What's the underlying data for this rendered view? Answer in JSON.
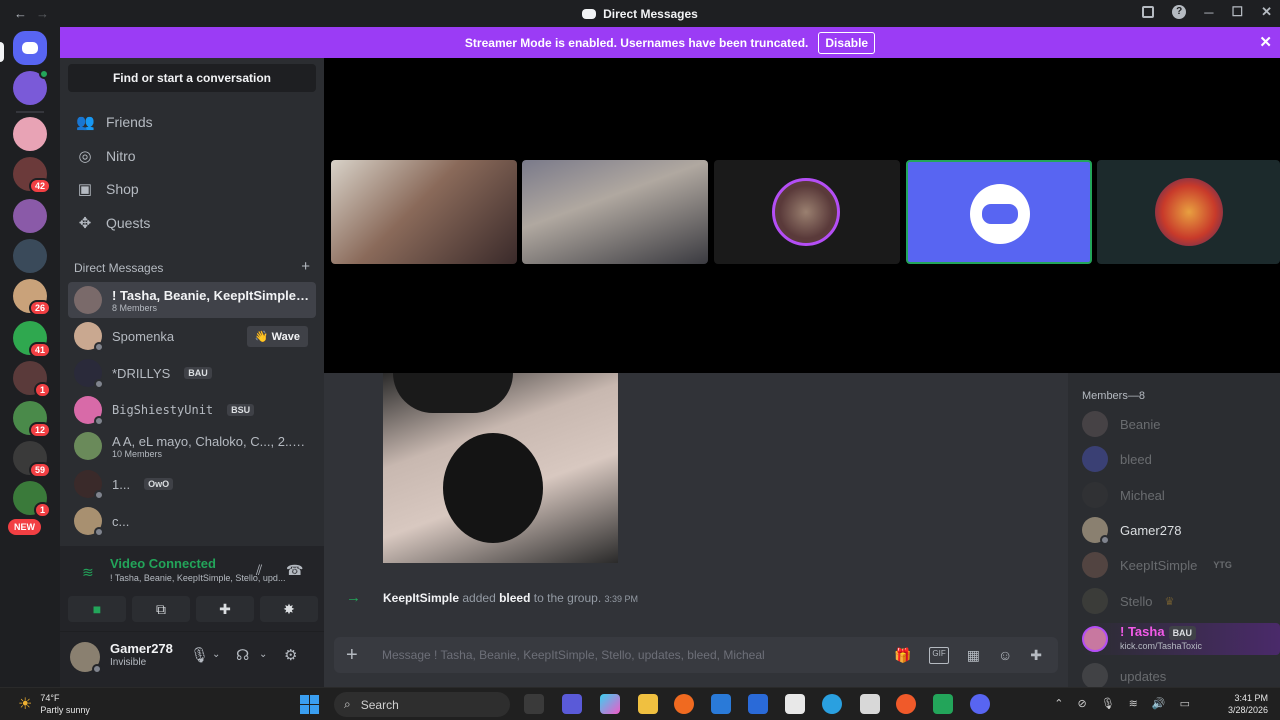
{
  "window": {
    "title": "Direct Messages",
    "back_icon": "arrow-left-icon",
    "forward_icon": "arrow-right-icon"
  },
  "banner": {
    "text": "Streamer Mode is enabled. Usernames have been truncated.",
    "button": "Disable",
    "color": "#9b3cf5"
  },
  "rail": {
    "badges": [
      "42",
      "26",
      "41",
      "1",
      "12",
      "59",
      "1"
    ],
    "new_label": "NEW"
  },
  "sidebar": {
    "search": "Find or start a conversation",
    "nav": [
      {
        "label": "Friends",
        "icon": "friends-icon"
      },
      {
        "label": "Nitro",
        "icon": "nitro-icon"
      },
      {
        "label": "Shop",
        "icon": "shop-icon"
      },
      {
        "label": "Quests",
        "icon": "quests-icon"
      }
    ],
    "dm_header": "Direct Messages",
    "dms": [
      {
        "name": "! Tasha, Beanie, KeepItSimple, St...",
        "sub": "8 Members"
      },
      {
        "name": "Spomenka",
        "action": "Wave"
      },
      {
        "name": "*DRILLYS",
        "tag": "BAU"
      },
      {
        "name": "BigShiestyUnit",
        "tag": "BSU"
      },
      {
        "name": "A A, eL mayo, Chaloko, C..., 2..., ...",
        "sub": "10 Members"
      },
      {
        "name": "1...",
        "tag": "OwO"
      },
      {
        "name": "c..."
      }
    ]
  },
  "voice": {
    "title": "Video Connected",
    "sub": "! Tasha, Beanie, KeepItSimple, Stello, upd..."
  },
  "user": {
    "name": "Gamer278",
    "status": "Invisible"
  },
  "chat": {
    "system_actor": "KeepItSimple",
    "system_action": "added",
    "system_target": "bleed",
    "system_rest": "to the group.",
    "system_time": "3:39 PM",
    "placeholder": "Message ! Tasha, Beanie, KeepItSimple, Stello, updates, bleed, Micheal"
  },
  "members": {
    "header": "Members—8",
    "list": [
      {
        "name": "Beanie",
        "online": false
      },
      {
        "name": "bleed",
        "online": false
      },
      {
        "name": "Micheal",
        "online": false
      },
      {
        "name": "Gamer278",
        "online": true
      },
      {
        "name": "KeepItSimple",
        "online": false,
        "tag": "YTG"
      },
      {
        "name": "Stello",
        "online": false
      },
      {
        "name": "! Tasha",
        "online": true,
        "tag": "BAU",
        "activity": "kick.com/TashaToxic"
      },
      {
        "name": "updates",
        "online": false
      }
    ]
  },
  "taskbar": {
    "temp": "74°F",
    "weather": "Partly sunny",
    "search": "Search",
    "time": "3:41 PM",
    "date": "3/28/2026"
  }
}
